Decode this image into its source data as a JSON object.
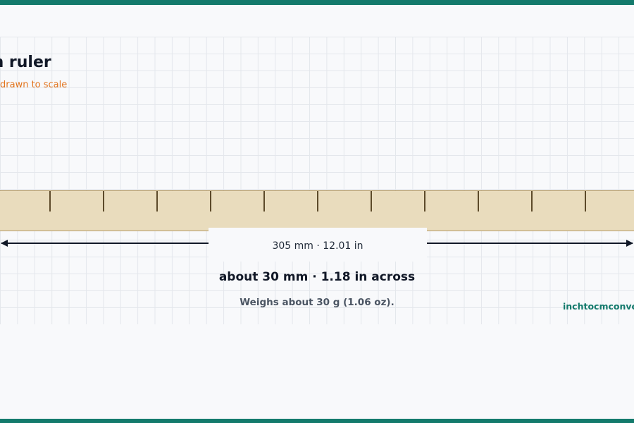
{
  "header": {
    "title": "ich ruler",
    "subtitle": "drawn to scale"
  },
  "ruler": {
    "length_label": "305 mm · 12.01 in",
    "width_label": "about 30 mm · 1.18 in across",
    "weight_label": "Weighs about 30 g (1.06 oz).",
    "tick_count": 11
  },
  "footer": {
    "brand": "inchtocmconver"
  },
  "colors": {
    "accent": "#137a6c",
    "ruler_fill": "#e9dcbd",
    "ruler_edge": "#b49a66",
    "tick": "#5c4a2a",
    "subtitle": "#e2731c"
  }
}
